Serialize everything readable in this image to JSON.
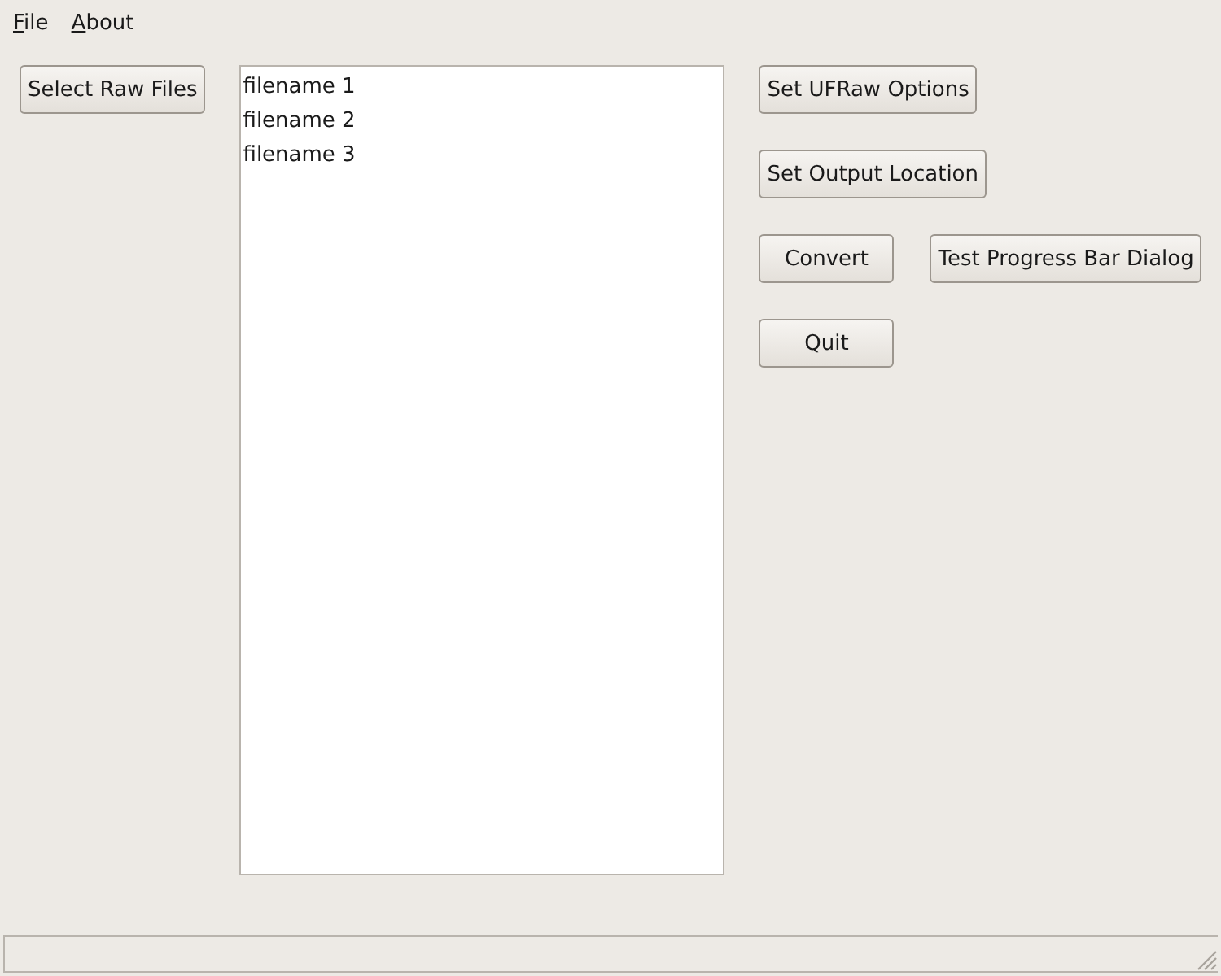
{
  "menu": [
    {
      "label": "File"
    },
    {
      "label": "About"
    }
  ],
  "select_button": "Select Raw Files",
  "file_list": [
    "filename 1",
    "filename 2",
    "filename 3"
  ],
  "actions": [
    [
      "Set UFRaw Options"
    ],
    [
      "Set Output Location"
    ],
    [
      "Convert",
      "Test Progress Bar Dialog"
    ],
    [
      "Quit"
    ]
  ]
}
